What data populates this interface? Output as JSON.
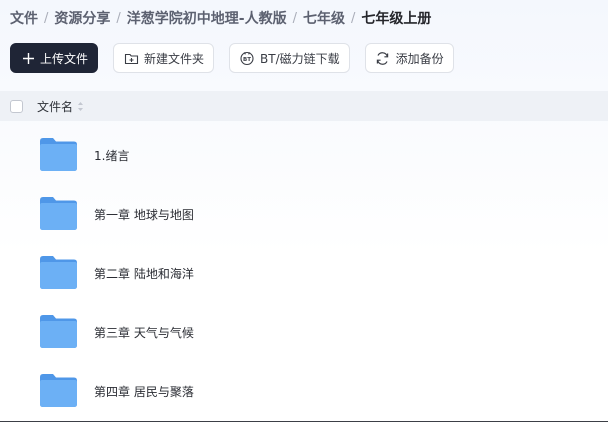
{
  "breadcrumb": {
    "items": [
      "文件",
      "资源分享",
      "洋葱学院初中地理-人教版",
      "七年级",
      "七年级上册"
    ],
    "separator": "/"
  },
  "toolbar": {
    "upload_label": "上传文件",
    "new_folder_label": "新建文件夹",
    "bt_label": "BT/磁力链下载",
    "backup_label": "添加备份"
  },
  "table": {
    "column_name": "文件名"
  },
  "files": [
    {
      "name": "1.绪言",
      "icon": "folder-icon"
    },
    {
      "name": "第一章 地球与地图",
      "icon": "folder-icon"
    },
    {
      "name": "第二章  陆地和海洋",
      "icon": "folder-icon"
    },
    {
      "name": "第三章  天气与气候",
      "icon": "folder-icon"
    },
    {
      "name": "第四章 居民与聚落",
      "icon": "folder-icon"
    }
  ],
  "colors": {
    "primary_button": "#1f2536",
    "folder": "#5ba3f0",
    "header_bg": "#eef1f6"
  }
}
